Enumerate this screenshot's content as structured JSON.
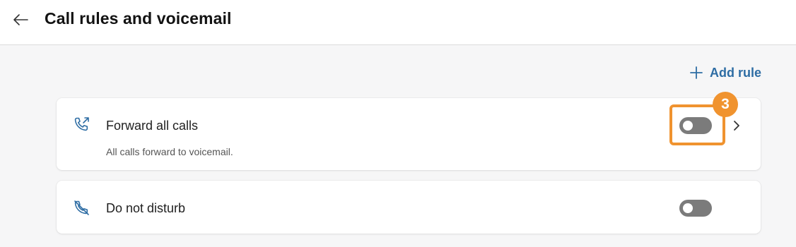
{
  "header": {
    "title": "Call rules and voicemail",
    "back_icon": "arrow-left-icon"
  },
  "actions": {
    "add_rule_label": "Add rule",
    "add_rule_icon": "plus-icon"
  },
  "rules": [
    {
      "title": "Forward all calls",
      "subtitle": "All calls forward to voicemail.",
      "icon": "phone-forward-icon",
      "enabled": false,
      "has_chevron": true
    },
    {
      "title": "Do not disturb",
      "icon": "phone-muted-icon",
      "enabled": false,
      "has_chevron": false
    }
  ],
  "annotation": {
    "step_number": "3",
    "color": "#f0932f"
  },
  "colors": {
    "accent": "#2e6da4",
    "toggle_off": "#7b7b7b"
  }
}
